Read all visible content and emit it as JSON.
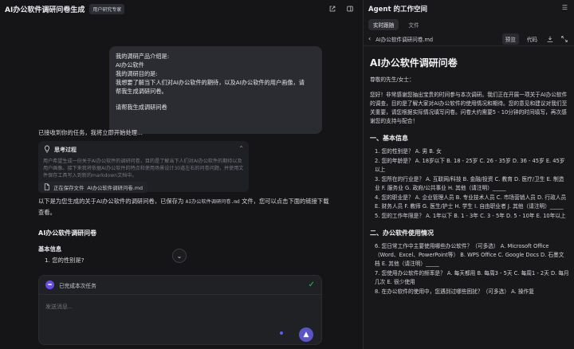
{
  "left": {
    "title": "AI办公软件调研问卷生成",
    "tag": "用户研究专家",
    "bubble_lines": [
      "我的调研产品介绍是:",
      "AI办公软件",
      "我的调研目的是:",
      "我想要了解当下人们对AI办公软件的期待，以及AI办公软件的用户画像，请",
      "帮我生成调研问卷。",
      "",
      "请帮我生成调研问卷"
    ],
    "status_msg": "已接收到你的任务，我将立即开始处理...",
    "think": {
      "title": "思考过程",
      "body": "用户希望生成一份关于AI办公软件的调研问卷，目的是了解当下人们对AI办公软件的期待以及用户画像。接下来我将依据AI办公软件的特点和使用场景设计30道左右的问卷问题，并使用文件保存工具写入到新的markdown文档中。"
    },
    "saving": {
      "label": "正在保存文件",
      "filename": "AI办公软件调研问卷.md"
    },
    "result_msg_prefix": "以下是为您生成的关于AI办公软件的调研问卷，已保存为",
    "result_msg_file": "AI办公软件调研问卷.md",
    "result_msg_suffix": "文件，您可以点击下面的链接下载查看。",
    "doc_title": "AI办公软件调研问卷",
    "section_title": "基本信息",
    "q1": "1. 您的性别是?",
    "composer": {
      "task_done": "已完成本次任务",
      "placeholder": "发送消息...",
      "send": "▲"
    }
  },
  "right": {
    "title": "Agent 的工作空间",
    "tabs": [
      "实时跟随",
      "文件"
    ],
    "file_name": "AI办公软件调研问卷.md",
    "file_buttons": [
      "预览",
      "代码"
    ],
    "doc": {
      "h1": "AI办公软件调研问卷",
      "greeting": "尊敬的先生/女士：",
      "intro": "您好！非常感谢您抽出宝贵的时间参与本次调研。我们正在开展一项关于AI办公软件的调查，目的是了解大家对AI办公软件的使用情况和期待。您的意见和建议对我们至关重要，请您根据实际情况填写问卷。问卷大约需要5 - 10分钟的时间填写，再次感谢您的支持与配合！",
      "sections": [
        {
          "title": "一、基本信息",
          "items": [
            "1. 您的性别是？ A. 男 B. 女",
            "2. 您的年龄是？ A. 18岁以下 B. 18 - 25岁 C. 26 - 35岁 D. 36 - 45岁 E. 45岁以上",
            "3. 您所在的行业是？ A. 互联网/科技 B. 金融/投资 C. 教育 D. 医疗/卫生 E. 制造业 F. 服务业 G. 政府/公共事业 H. 其他（请注明）_____",
            "4. 您的职业是？ A. 企业管理人员 B. 专业技术人员 C. 市场营销人员 D. 行政人员 E. 财务人员 F. 教师 G. 医生/护士 H. 学生 I. 自由职业者 J. 其他（请注明）_____",
            "5. 您的工作年限是？ A. 1年以下 B. 1 - 3年 C. 3 - 5年 D. 5 - 10年 E. 10年以上"
          ]
        },
        {
          "title": "二、办公软件使用情况",
          "items": [
            "6. 您日常工作中主要使用哪些办公软件？（可多选） A. Microsoft Office（Word、Excel、PowerPoint等） B. WPS Office C. Google Docs D. 石墨文档 E. 其他（请注明）_____",
            "7. 您使用办公软件的频率是？ A. 每天都用 B. 每周3 - 5天 C. 每周1 - 2天 D. 每月几次 E. 很少使用",
            "8. 在办公软件的使用中，您遇到过哪些困扰？（可多选） A. 操作复"
          ]
        }
      ]
    }
  }
}
